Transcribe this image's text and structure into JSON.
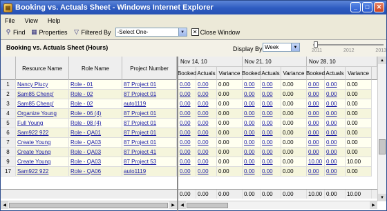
{
  "window": {
    "title": "Booking vs. Actuals Sheet - Windows Internet Explorer",
    "min_label": "_",
    "max_label": "□",
    "close_label": "✕"
  },
  "menu": [
    "File",
    "View",
    "Help"
  ],
  "toolbar": {
    "find": "Find",
    "properties": "Properties",
    "filtered_by": "Filtered By",
    "filter_value": "-Select One-",
    "close_window": "Close Window"
  },
  "sheet": {
    "title": "Booking vs. Actuals Sheet (Hours)",
    "display_by_label": "Display By:",
    "display_by_value": "Week",
    "slider_years": [
      "2011",
      "2012",
      "2013"
    ]
  },
  "columns": {
    "resource": "Resource Name",
    "role": "Role Name",
    "project": "Project Number"
  },
  "weeks": [
    {
      "label": "Nov 14, 10"
    },
    {
      "label": "Nov 21, 10"
    },
    {
      "label": "Nov 28, 10"
    }
  ],
  "subcols": [
    "Booked",
    "Actuals",
    "Variance"
  ],
  "rows": [
    {
      "n": "1",
      "resource": "Nancy Plucy",
      "role": "Role - 01",
      "project": "87 Project 01",
      "w1": [
        "0.00",
        "0.00",
        "0.00"
      ],
      "w2": [
        "0.00",
        "0.00",
        "0.00"
      ],
      "w3": [
        "0.00",
        "0.00",
        "0.00"
      ]
    },
    {
      "n": "2",
      "resource": "Sam85 Cheng'",
      "role": "Role - 02",
      "project": "87 Project 01",
      "w1": [
        "0.00",
        "0.00",
        "0.00"
      ],
      "w2": [
        "0.00",
        "0.00",
        "0.00"
      ],
      "w3": [
        "0.00",
        "0.00",
        "0.00"
      ]
    },
    {
      "n": "3",
      "resource": "Sam85 Cheng'",
      "role": "Role - 02",
      "project": "auto1119",
      "w1": [
        "0.00",
        "0.00",
        "0.00"
      ],
      "w2": [
        "0.00",
        "0.00",
        "0.00"
      ],
      "w3": [
        "0.00",
        "0.00",
        "0.00"
      ]
    },
    {
      "n": "4",
      "resource": "Organize Young",
      "role": "Role - 06 (4)",
      "project": "87 Project 01",
      "w1": [
        "0.00",
        "0.00",
        "0.00"
      ],
      "w2": [
        "0.00",
        "0.00",
        "0.00"
      ],
      "w3": [
        "0.00",
        "0.00",
        "0.00"
      ]
    },
    {
      "n": "5",
      "resource": "Full Young",
      "role": "Role - 08 (4)",
      "project": "87 Project 01",
      "w1": [
        "0.00",
        "0.00",
        "0.00"
      ],
      "w2": [
        "0.00",
        "0.00",
        "0.00"
      ],
      "w3": [
        "0.00",
        "0.00",
        "0.00"
      ]
    },
    {
      "n": "6",
      "resource": "Sam922 922",
      "role": "Role - QA01",
      "project": "87 Project 01",
      "w1": [
        "0.00",
        "0.00",
        "0.00"
      ],
      "w2": [
        "0.00",
        "0.00",
        "0.00"
      ],
      "w3": [
        "0.00",
        "0.00",
        "0.00"
      ]
    },
    {
      "n": "7",
      "resource": "Create Young",
      "role": "Role - QA03",
      "project": "87 Project 01",
      "w1": [
        "0.00",
        "0.00",
        "0.00"
      ],
      "w2": [
        "0.00",
        "0.00",
        "0.00"
      ],
      "w3": [
        "0.00",
        "0.00",
        "0.00"
      ]
    },
    {
      "n": "8",
      "resource": "Create Young",
      "role": "Role - QA03",
      "project": "87 Project 41",
      "w1": [
        "0.00",
        "0.00",
        "0.00"
      ],
      "w2": [
        "0.00",
        "0.00",
        "0.00"
      ],
      "w3": [
        "0.00",
        "0.00",
        "0.00"
      ]
    },
    {
      "n": "9",
      "resource": "Create Young",
      "role": "Role - QA03",
      "project": "87 Project 53",
      "w1": [
        "0.00",
        "0.00",
        "0.00"
      ],
      "w2": [
        "0.00",
        "0.00",
        "0.00"
      ],
      "w3": [
        "10.00",
        "0.00",
        "10.00"
      ]
    },
    {
      "n": "17",
      "resource": "Sam922 922",
      "role": "Role - QA06",
      "project": "auto1119",
      "w1": [
        "0.00",
        "0.00",
        "0.00"
      ],
      "w2": [
        "0.00",
        "0.00",
        "0.00"
      ],
      "w3": [
        "0.00",
        "0.00",
        "0.00"
      ]
    }
  ],
  "totals": {
    "w1": [
      "0.00",
      "0.00",
      "0.00"
    ],
    "w2": [
      "0.00",
      "0.00",
      "0.00"
    ],
    "w3": [
      "10.00",
      "0.00",
      "10.00"
    ]
  },
  "colors": {
    "titlebar": "#2e5bc0",
    "link": "#1a1aa6",
    "row_even": "#fffff0",
    "row_alt": "#f5f5dc"
  }
}
